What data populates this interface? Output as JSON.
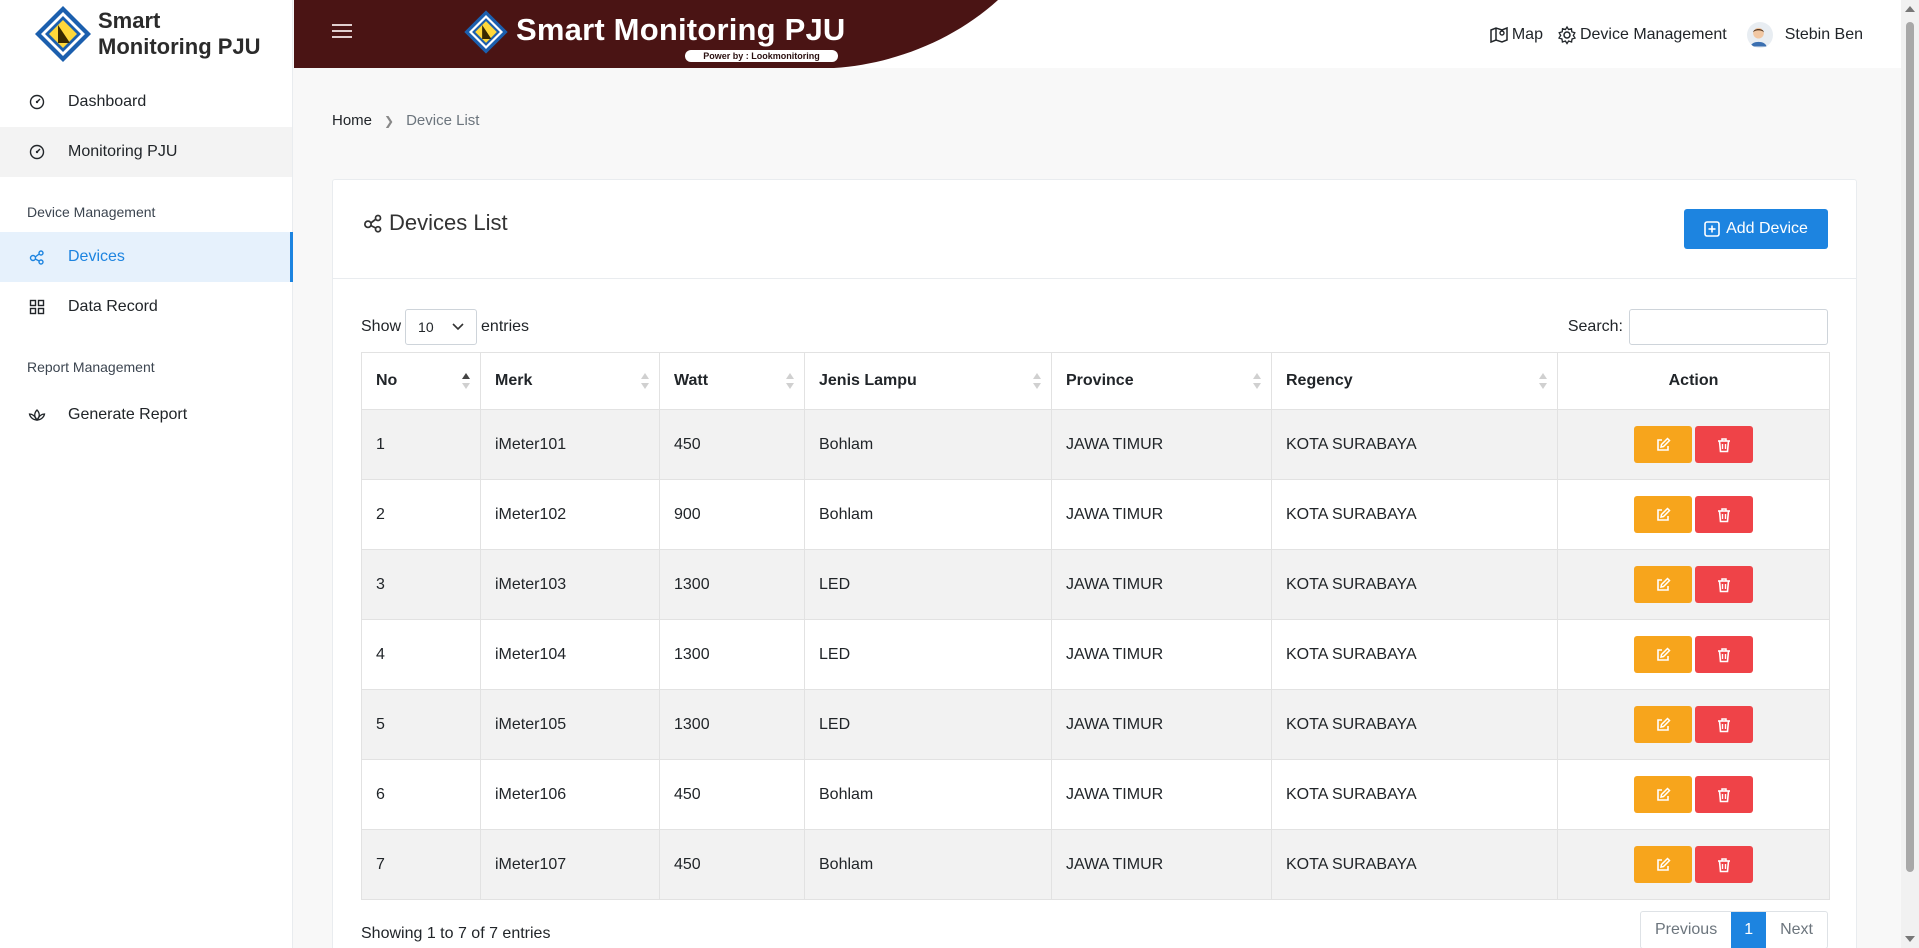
{
  "brand": {
    "line1": "Smart",
    "line2": "Monitoring PJU"
  },
  "header": {
    "title": "Smart Monitoring PJU",
    "power_text": "Power by : Lookmonitoring",
    "links": {
      "map": "Map",
      "device_management": "Device Management",
      "user": "Stebin Ben"
    },
    "colors": {
      "banner": "#4a1414"
    }
  },
  "sidebar": {
    "dashboard": "Dashboard",
    "monitoring": "Monitoring PJU",
    "section_device": "Device Management",
    "devices": "Devices",
    "data_record": "Data Record",
    "section_report": "Report Management",
    "generate_report": "Generate Report"
  },
  "breadcrumb": {
    "home": "Home",
    "current": "Device List"
  },
  "card": {
    "title": "Devices List",
    "add_button": "Add Device",
    "show_label": "Show",
    "entries_value": "10",
    "entries_label": "entries",
    "search_label": "Search:",
    "search_value": ""
  },
  "table": {
    "columns": [
      "No",
      "Merk",
      "Watt",
      "Jenis Lampu",
      "Province",
      "Regency",
      "Action"
    ],
    "rows": [
      [
        "1",
        "iMeter101",
        "450",
        "Bohlam",
        "JAWA TIMUR",
        "KOTA SURABAYA"
      ],
      [
        "2",
        "iMeter102",
        "900",
        "Bohlam",
        "JAWA TIMUR",
        "KOTA SURABAYA"
      ],
      [
        "3",
        "iMeter103",
        "1300",
        "LED",
        "JAWA TIMUR",
        "KOTA SURABAYA"
      ],
      [
        "4",
        "iMeter104",
        "1300",
        "LED",
        "JAWA TIMUR",
        "KOTA SURABAYA"
      ],
      [
        "5",
        "iMeter105",
        "1300",
        "LED",
        "JAWA TIMUR",
        "KOTA SURABAYA"
      ],
      [
        "6",
        "iMeter106",
        "450",
        "Bohlam",
        "JAWA TIMUR",
        "KOTA SURABAYA"
      ],
      [
        "7",
        "iMeter107",
        "450",
        "Bohlam",
        "JAWA TIMUR",
        "KOTA SURABAYA"
      ]
    ]
  },
  "footer": {
    "info": "Showing 1 to 7 of 7 entries",
    "previous": "Previous",
    "page": "1",
    "next": "Next"
  }
}
